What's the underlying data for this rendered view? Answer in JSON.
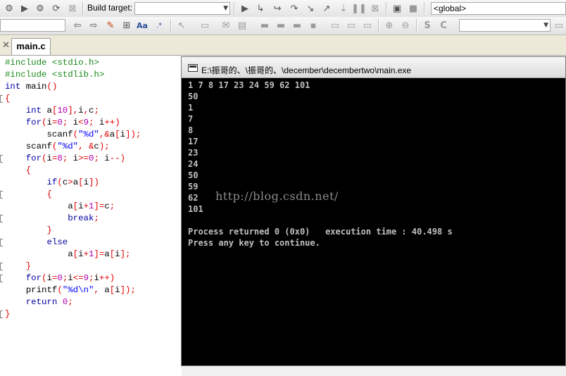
{
  "toolbar": {
    "build_target_label": "Build target:",
    "build_target_value": "",
    "scope_value": "<global>",
    "search_value": ""
  },
  "tab": {
    "label": "main.c",
    "close_glyph": "✕"
  },
  "editor": {
    "lines": [
      "#include <stdio.h>",
      "#include <stdlib.h>",
      "int main()",
      "{",
      "    int a[10],i,c;",
      "    for(i=0; i<9; i++)",
      "        scanf(\"%d\",&a[i]);",
      "    scanf(\"%d\", &c);",
      "    for(i=8; i>=0; i--)",
      "    {",
      "        if(c>a[i])",
      "        {",
      "            a[i+1]=c;",
      "            break;",
      "        }",
      "        else",
      "            a[i+1]=a[i];",
      "    }",
      "    for(i=0;i<=9;i++)",
      "    printf(\"%d\\n\", a[i]);",
      "    return 0;",
      "}"
    ]
  },
  "console": {
    "title": "E:\\振哥的、\\振哥的、\\december\\decembertwo\\main.exe",
    "output": [
      "1 7 8 17 23 24 59 62 101",
      "50",
      "1",
      "7",
      "8",
      "17",
      "23",
      "24",
      "50",
      "59",
      "62",
      "101",
      "",
      "Process returned 0 (0x0)   execution time : 40.498 s",
      "Press any key to continue."
    ]
  },
  "watermark": "http://blog.csdn.net/"
}
